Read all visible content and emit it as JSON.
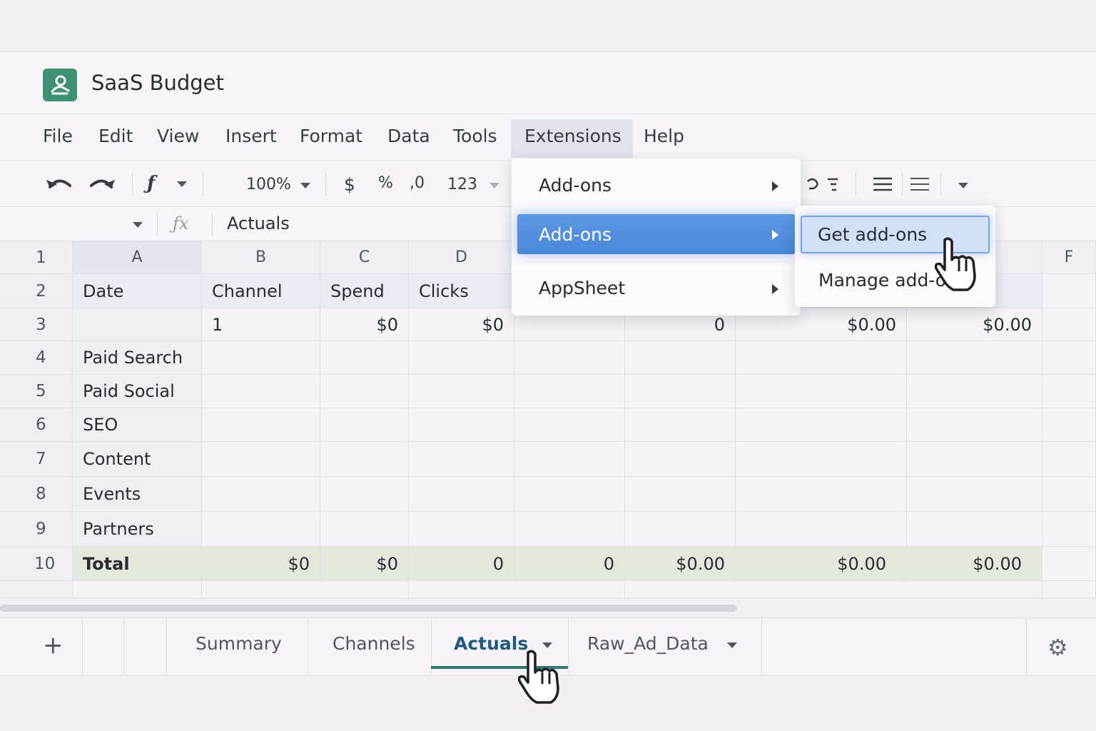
{
  "app": {
    "title": "SaaS Budget",
    "accent": "#3d9272"
  },
  "menubar": {
    "items": [
      "File",
      "Edit",
      "View",
      "Insert",
      "Format",
      "Data",
      "Tools",
      "Extensions",
      "Help"
    ],
    "active": "Extensions"
  },
  "toolbar": {
    "zoom": "100%",
    "currency": "$",
    "percent": "%",
    "decimal": ",0",
    "number_format": "123"
  },
  "formula_bar": {
    "fx": "ƒx",
    "value": "Actuals"
  },
  "grid": {
    "column_headers": [
      "A",
      "B",
      "C",
      "D",
      "F"
    ],
    "row_numbers": [
      "1",
      "2",
      "3",
      "4",
      "5",
      "6",
      "7",
      "8",
      "9",
      "10"
    ],
    "header_row": [
      "Date",
      "Channel",
      "Spend",
      "Clicks"
    ],
    "row3": [
      "1",
      "$0",
      "$0",
      "0",
      "$0.00",
      "$0.00"
    ],
    "categories": [
      "Paid Search",
      "Paid Social",
      "SEO",
      "Content",
      "Events",
      "Partners"
    ],
    "total_row": [
      "Total",
      "$0",
      "$0",
      "0",
      "0",
      "$0.00",
      "$0.00",
      "$0.00"
    ]
  },
  "extensions_menu": {
    "items": [
      {
        "label": "Add-ons"
      },
      {
        "label": "Add-ons",
        "highlighted": true
      },
      {
        "label": "AppSheet"
      }
    ]
  },
  "addons_submenu": {
    "items": [
      "Get add-ons",
      "Manage add-ons"
    ],
    "hovered": "Get add-ons"
  },
  "sheet_tabs": {
    "tabs": [
      "Summary",
      "Channels",
      "Actuals",
      "Raw_Ad_Data"
    ],
    "active": "Actuals"
  },
  "icons": [
    "undo-icon",
    "redo-icon",
    "function-icon",
    "align-icon",
    "settings-gear-icon",
    "pointer-hand-icon"
  ]
}
